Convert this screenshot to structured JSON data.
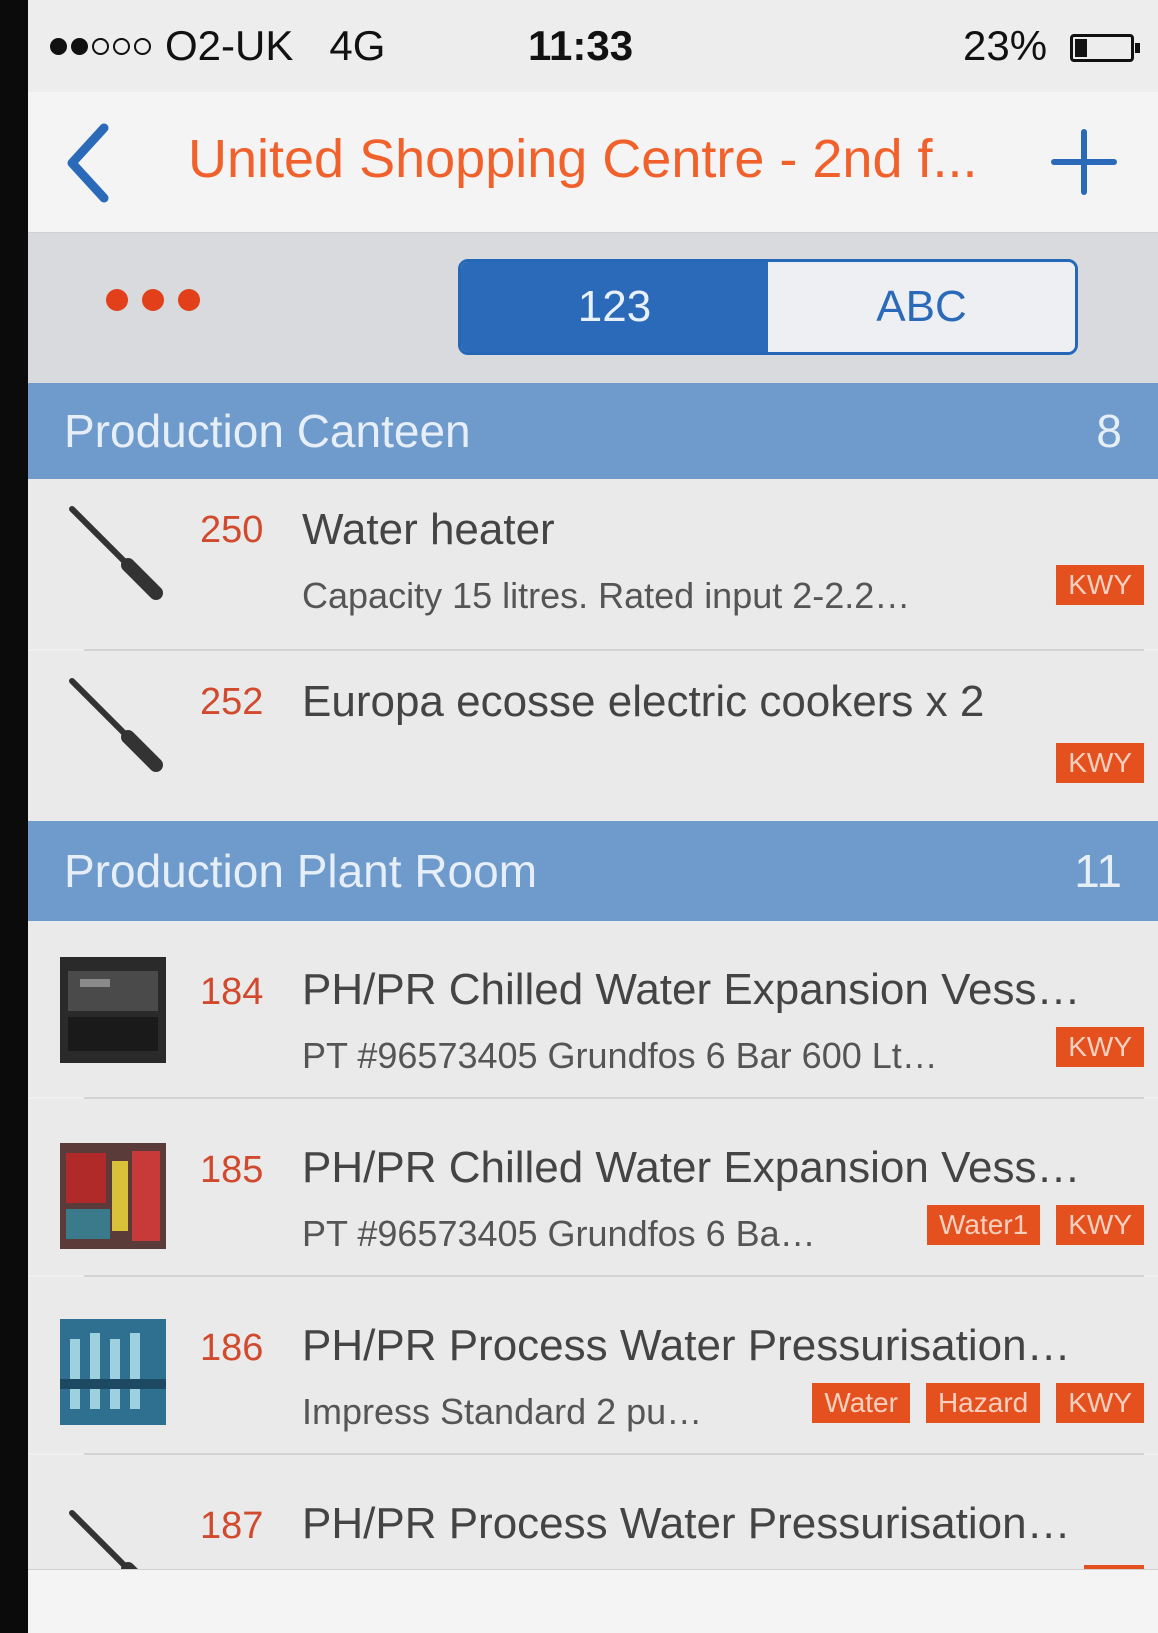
{
  "status_bar": {
    "carrier": "O2-UK",
    "network": "4G",
    "time": "11:33",
    "battery": "23%",
    "battery_level": 0.23
  },
  "nav": {
    "back_icon": "chevron-left-icon",
    "title": "United Shopping Centre - 2nd f...",
    "add_icon": "plus-icon"
  },
  "toolbar": {
    "more_icon": "more-dots-icon",
    "segments": [
      "123",
      "ABC"
    ],
    "selected_segment": "123"
  },
  "sections": [
    {
      "name": "Production Canteen",
      "count": "8",
      "items": [
        {
          "icon": "screwdriver-icon",
          "number": "250",
          "title": "Water heater",
          "subtitle": "Capacity 15 litres. Rated input 2-2.2…",
          "tags": [
            "KWY"
          ]
        },
        {
          "icon": "screwdriver-icon",
          "number": "252",
          "title": "Europa ecosse electric cookers x 2",
          "subtitle": "",
          "tags": [
            "KWY"
          ]
        }
      ]
    },
    {
      "name": "Production Plant Room",
      "count": "11",
      "items": [
        {
          "icon": "asset-photo",
          "number": "184",
          "title": "PH/PR Chilled Water Expansion Vess…",
          "subtitle": "PT #96573405 Grundfos 6 Bar 600 Lt…",
          "tags": [
            "KWY"
          ]
        },
        {
          "icon": "asset-photo",
          "number": "185",
          "title": "PH/PR Chilled Water Expansion Vess…",
          "subtitle": "PT #96573405 Grundfos 6 Ba…",
          "tags": [
            "Water1",
            "KWY"
          ]
        },
        {
          "icon": "asset-photo",
          "number": "186",
          "title": "PH/PR Process Water Pressurisation…",
          "subtitle": "Impress Standard 2 pu…",
          "tags": [
            "Water",
            "Hazard",
            "KWY"
          ]
        },
        {
          "icon": "screwdriver-icon",
          "number": "187",
          "title": "PH/PR Process Water Pressurisation…",
          "subtitle": "",
          "tags": []
        }
      ]
    }
  ],
  "colors": {
    "accent_orange": "#f0612c",
    "tag_orange": "#e5511e",
    "blue": "#2b6ab8",
    "section_blue": "#6f9acc"
  }
}
